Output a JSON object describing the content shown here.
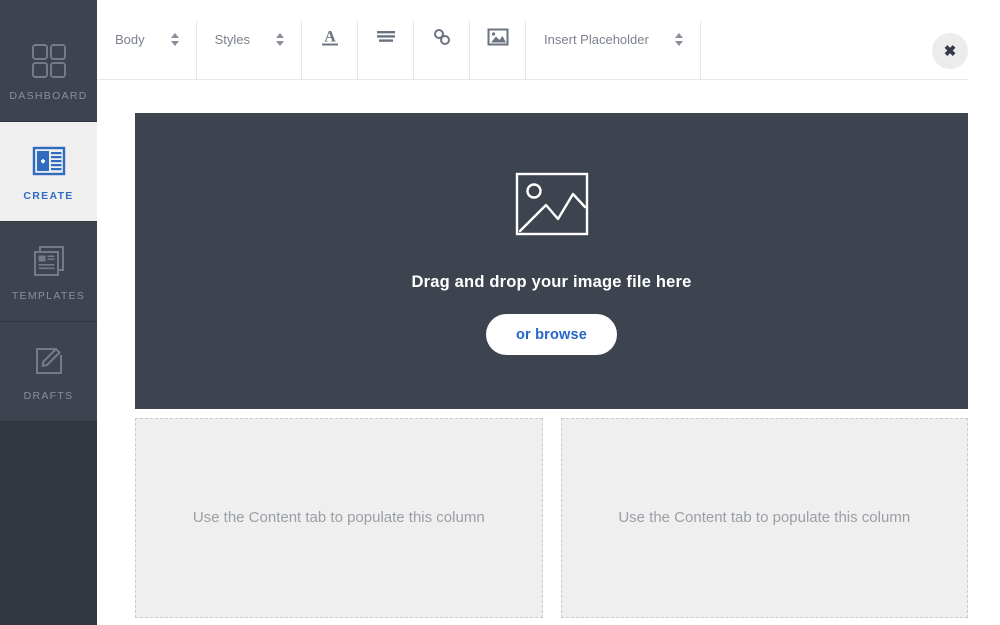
{
  "sidebar": {
    "background": "#31363f",
    "item_background": "#3e444f",
    "active_background": "#efeff0",
    "accent": "#2f6cc0",
    "items": [
      {
        "label": "DASHBOARD",
        "icon": "grid-icon",
        "active": false
      },
      {
        "label": "CREATE",
        "icon": "create-article-icon",
        "active": true
      },
      {
        "label": "TEMPLATES",
        "icon": "templates-stack-icon",
        "active": false
      },
      {
        "label": "DRAFTS",
        "icon": "pencil-square-icon",
        "active": false
      }
    ]
  },
  "toolbar": {
    "block_select": {
      "value": "Body",
      "icon": "stepper-icon"
    },
    "styles_select": {
      "value": "Styles",
      "icon": "stepper-icon"
    },
    "buttons": [
      {
        "name": "text-format-icon",
        "title": "A"
      },
      {
        "name": "align-icon",
        "title": "Align"
      },
      {
        "name": "link-icon",
        "title": "Link"
      },
      {
        "name": "image-icon",
        "title": "Image"
      }
    ],
    "placeholder_select": {
      "value": "Insert Placeholder",
      "icon": "stepper-icon"
    },
    "close": {
      "label": "✖",
      "icon": "close-icon"
    }
  },
  "dropzone": {
    "icon": "image-placeholder-icon",
    "message": "Drag and drop your image file here",
    "browse_label": "or browse",
    "background": "#3e444f",
    "button_text_color": "#2566c8"
  },
  "columns": [
    {
      "text": "Use the Content tab to populate this column"
    },
    {
      "text": "Use the Content tab to populate this column"
    }
  ]
}
